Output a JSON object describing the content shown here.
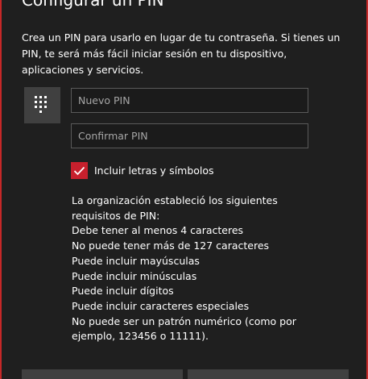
{
  "dialog": {
    "title": "Configurar un PIN",
    "description": "Crea un PIN para usarlo en lugar de tu contraseña. Si tienes un PIN, te será más fácil iniciar sesión en tu dispositivo, aplicaciones y servicios."
  },
  "form": {
    "new_pin_placeholder": "Nuevo PIN",
    "confirm_pin_placeholder": "Confirmar PIN",
    "include_letters_label": "Incluir letras y símbolos",
    "include_letters_checked": true
  },
  "requirements": {
    "lines": [
      "La organización estableció los siguientes",
      "requisitos de PIN:",
      "Debe tener al menos 4 caracteres",
      "No puede tener más de 127 caracteres",
      "Puede incluir mayúsculas",
      "Puede incluir minúsculas",
      "Puede incluir dígitos",
      "Puede incluir caracteres especiales",
      "No puede ser un patrón numérico (como por",
      "ejemplo, 123456 o 11111)."
    ]
  },
  "icons": {
    "keypad": "keypad-icon",
    "check": "checkmark-icon"
  },
  "colors": {
    "background": "#1f1f1f",
    "accent": "#c7202d",
    "tile": "#404040",
    "input_border": "#5a5a5a",
    "placeholder": "#a6a6a6"
  }
}
